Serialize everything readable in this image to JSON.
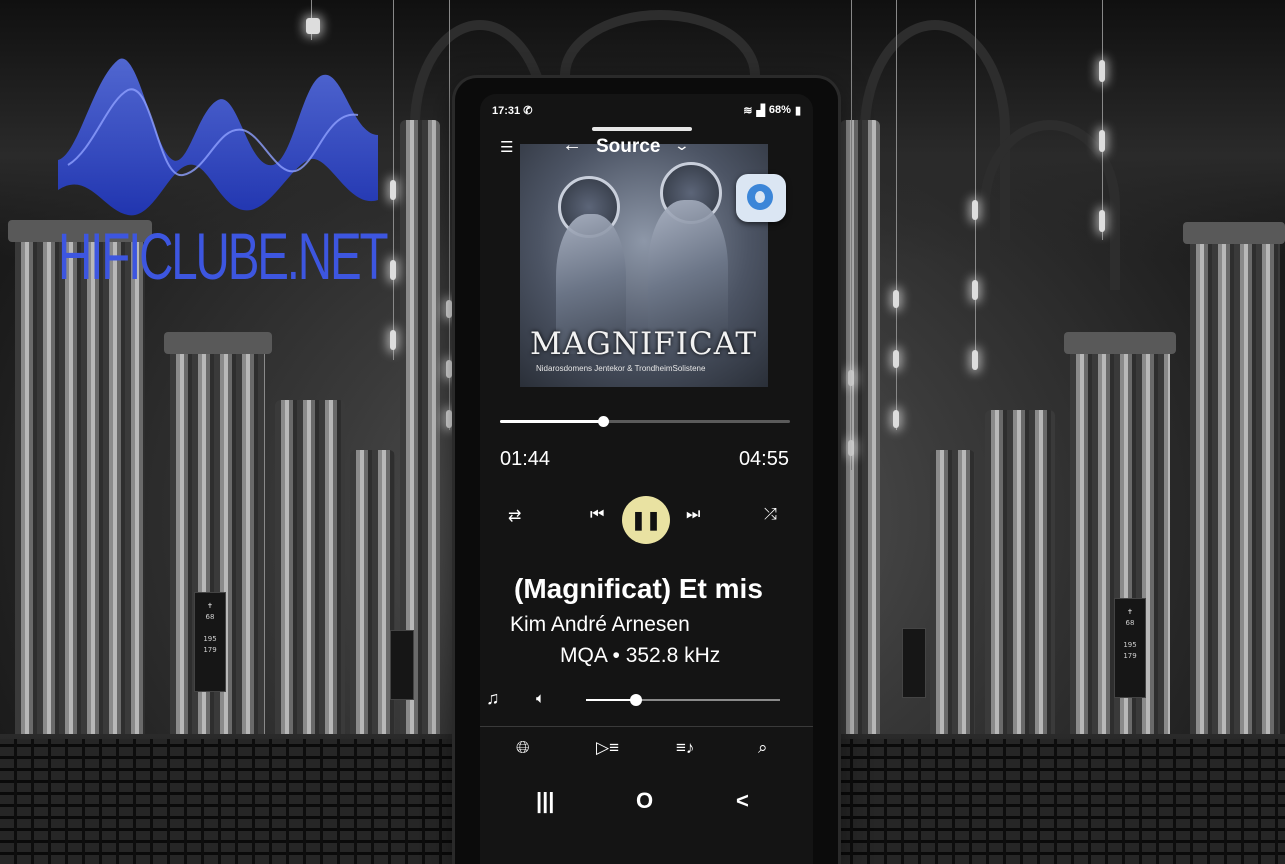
{
  "watermark": {
    "text": "HIFICLUBE.NET",
    "color": "#3d56e0"
  },
  "status_bar": {
    "time": "17:31",
    "notification_icon": "whatsapp-icon",
    "wifi_icon": "wifi-icon",
    "signal_icon": "signal-icon",
    "battery": "68%"
  },
  "header": {
    "menu_icon": "hamburger-icon",
    "back_icon": "back-arrow-icon",
    "title": "Source",
    "dropdown_icon": "chevron-down-icon"
  },
  "album_art": {
    "title": "MAGNIFICAT",
    "subtitle": "Nidarosdomens Jentekor & TrondheimSolistene",
    "overlay_badge": "whatsapp-badge"
  },
  "playback": {
    "elapsed": "01:44",
    "total": "04:55",
    "progress": 0.354
  },
  "controls": {
    "repeat_icon": "repeat-icon",
    "previous_icon": "skip-previous-icon",
    "play_pause_icon": "pause-icon",
    "next_icon": "skip-next-icon",
    "shuffle_icon": "shuffle-icon"
  },
  "track": {
    "title": "(Magnificat) Et mis",
    "artist": "Kim André Arnesen",
    "quality": "MQA • 352.8 kHz"
  },
  "volume": {
    "level": 0.26,
    "lyrics_icon": "music-note-icon",
    "speaker_icon": "speaker-icon"
  },
  "bottom_tabs": [
    {
      "icon": "globe-icon"
    },
    {
      "icon": "queue-play-icon"
    },
    {
      "icon": "playlist-icon"
    },
    {
      "icon": "search-icon"
    }
  ],
  "navigation_bar": {
    "recents": "|||",
    "home": "O",
    "back": "<"
  }
}
